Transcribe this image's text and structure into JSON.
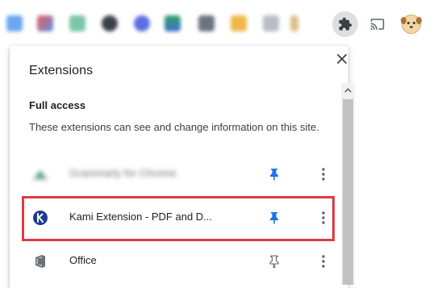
{
  "toolbar": {
    "extension_icons": [
      {
        "name": "blurred-extension-1",
        "color": "#6aa7f0"
      },
      {
        "name": "blurred-extension-2",
        "color": "#e85d5d"
      },
      {
        "name": "blurred-extension-3",
        "color": "#7cc6a8"
      },
      {
        "name": "blurred-extension-4",
        "color": "#3a4048"
      },
      {
        "name": "blurred-extension-5",
        "color": "#5b6ee1"
      },
      {
        "name": "blurred-extension-6",
        "color": "#2fa36b"
      },
      {
        "name": "blurred-extension-7",
        "color": "#6c7480"
      },
      {
        "name": "blurred-extension-8",
        "color": "#f0b84a"
      },
      {
        "name": "blurred-extension-9",
        "color": "#b9bdc4"
      }
    ],
    "puzzle_icon": "extensions-puzzle-icon",
    "cast_icon": "cast-icon",
    "profile_icon": "profile-avatar-icon"
  },
  "popup": {
    "title": "Extensions",
    "close_label": "×",
    "section_heading": "Full access",
    "section_desc": "These extensions can see and change information on this site.",
    "items": [
      {
        "name": "Grammarly for Chrome",
        "icon": "grammarly-icon",
        "pinned": true
      },
      {
        "name": "Kami Extension - PDF and D...",
        "icon": "kami-icon",
        "pinned": true,
        "highlighted": true
      },
      {
        "name": "Office",
        "icon": "office-icon",
        "pinned": false
      }
    ]
  },
  "colors": {
    "accent": "#1a73e8",
    "highlight": "#e03a45",
    "kami": "#1f3a93"
  }
}
